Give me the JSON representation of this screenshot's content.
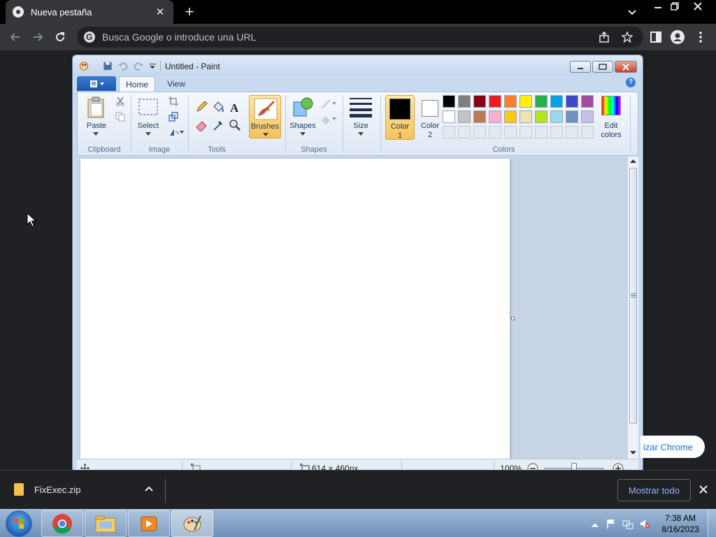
{
  "browser": {
    "tab_title": "Nueva pestaña",
    "omnibox_placeholder": "Busca Google o introduce una URL"
  },
  "paint": {
    "window_title": "Untitled - Paint",
    "tabs": [
      {
        "label": "Home",
        "active": true
      },
      {
        "label": "View",
        "active": false
      }
    ],
    "clipboard": {
      "paste": "Paste",
      "group": "Clipboard"
    },
    "image": {
      "select": "Select",
      "group": "Image"
    },
    "tools": {
      "group": "Tools"
    },
    "brushes": "Brushes",
    "shapes": {
      "label": "Shapes",
      "group": "Shapes"
    },
    "size": "Size",
    "colors": {
      "color1_line1": "Color",
      "color1_line2": "1",
      "color2_line1": "Color",
      "color2_line2": "2",
      "edit_line1": "Edit",
      "edit_line2": "colors",
      "group": "Colors",
      "primary": "#000000",
      "secondary": "#ffffff",
      "palette_row1": [
        "#000000",
        "#7f7f7f",
        "#880015",
        "#ed1c24",
        "#ff7f27",
        "#fff200",
        "#22b14c",
        "#00a2e8",
        "#3f48cc",
        "#a349a4"
      ],
      "palette_row2": [
        "#ffffff",
        "#c3c3c3",
        "#b97a57",
        "#ffaec9",
        "#ffc90e",
        "#efe4b0",
        "#b5e61d",
        "#99d9ea",
        "#7092be",
        "#c8bfe7"
      ]
    },
    "status": {
      "dimensions": "614 × 460px",
      "zoom": "100%"
    }
  },
  "downloads": {
    "file_name": "FixExec.zip",
    "show_all": "Mostrar todo"
  },
  "promo_text": "izar Chrome",
  "taskbar": {
    "time": "7:38 AM",
    "date": "8/16/2023"
  }
}
